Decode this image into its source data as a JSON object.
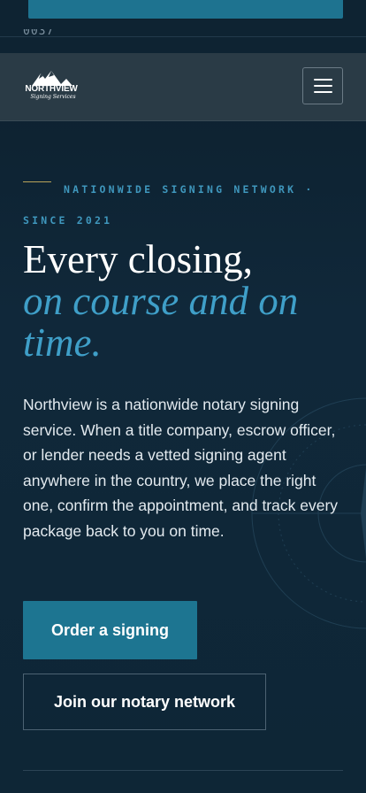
{
  "top": {
    "fragment": "0037"
  },
  "header": {
    "logo_word": "NORTHVIEW",
    "logo_sub": "Signing Services",
    "menu_icon": "hamburger-icon"
  },
  "hero": {
    "eyebrow": "NATIONWIDE SIGNING NETWORK · SINCE 2021",
    "title_line": "Every closing,",
    "title_accent": "on course and on time.",
    "lead": "Northview is a nationwide notary signing service. When a title company, escrow officer, or lender needs a vetted signing agent anywhere in the country, we place the right one, confirm the appointment, and track every package back to you on time.",
    "primary_cta": "Order a signing",
    "secondary_cta": "Join our notary network"
  },
  "colors": {
    "background": "#0f2433",
    "accent": "#3f9fc8",
    "button": "#1d7591",
    "gold_rule": "#b9a45a"
  }
}
